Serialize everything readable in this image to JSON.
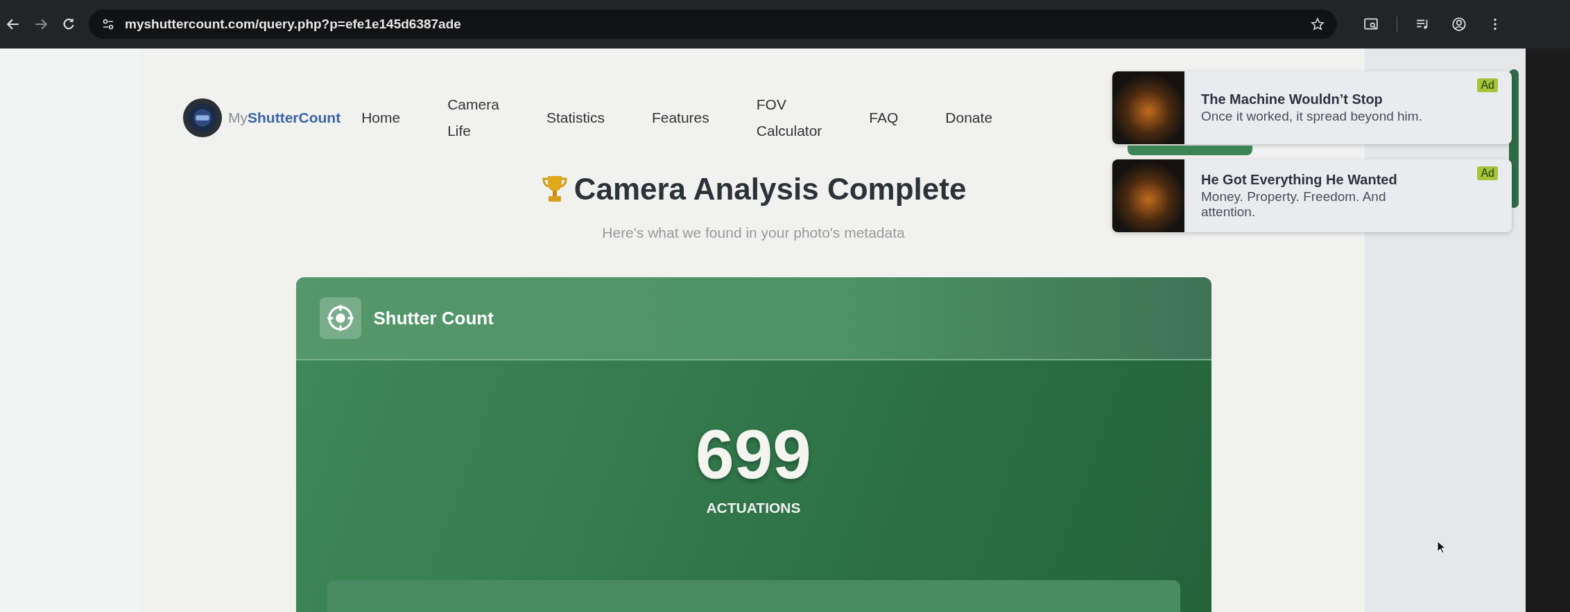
{
  "browser": {
    "url": "myshuttercount.com/query.php?p=efe1e145d6387ade"
  },
  "site": {
    "logo": {
      "prefix": "My",
      "name": "ShutterCount"
    },
    "nav": [
      {
        "label": "Home"
      },
      {
        "label": "Camera Life"
      },
      {
        "label": "Statistics"
      },
      {
        "label": "Features"
      },
      {
        "label": "FOV Calculator"
      },
      {
        "label": "FAQ"
      },
      {
        "label": "Donate"
      }
    ]
  },
  "heading": {
    "title": "Camera Analysis Complete",
    "subtitle": "Here's what we found in your photo's metadata"
  },
  "card": {
    "title": "Shutter Count",
    "count": "699",
    "unit": "ACTUATIONS"
  },
  "ads": [
    {
      "title": "The Machine Wouldn’t Stop",
      "description": "Once it worked, it spread beyond him.",
      "badge": "Ad"
    },
    {
      "title": "He Got Everything He Wanted",
      "description": "Money. Property. Freedom. And attention.",
      "badge": "Ad"
    }
  ]
}
